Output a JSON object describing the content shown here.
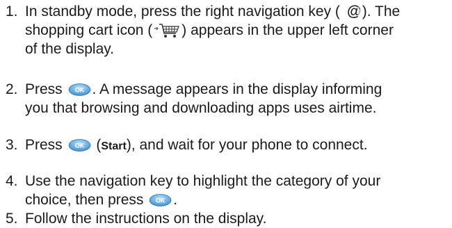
{
  "steps": [
    {
      "number": "1.",
      "part_a": "In standby mode, press the right navigation key (",
      "part_b": "). The",
      "part_c": "shopping cart icon (",
      "part_d": ") appears in the upper left corner",
      "part_e": "of the display."
    },
    {
      "number": "2.",
      "part_a": "Press",
      "part_b": ". A message appears in the display informing",
      "part_c": "you that browsing and downloading apps uses airtime."
    },
    {
      "number": "3.",
      "part_a": "Press",
      "part_b": "(",
      "bold": "Start",
      "part_c": "), and wait for your phone to connect."
    },
    {
      "number": "4.",
      "part_a": "Use the navigation key to highlight the category of your",
      "part_b": "choice, then press",
      "part_c": "."
    },
    {
      "number": "5.",
      "part_a": "Follow the instructions on the display."
    }
  ],
  "icons": {
    "ok_key_label": "OK",
    "nav_key_glyph": "@",
    "ok_key_color": "#5aa9dd"
  }
}
